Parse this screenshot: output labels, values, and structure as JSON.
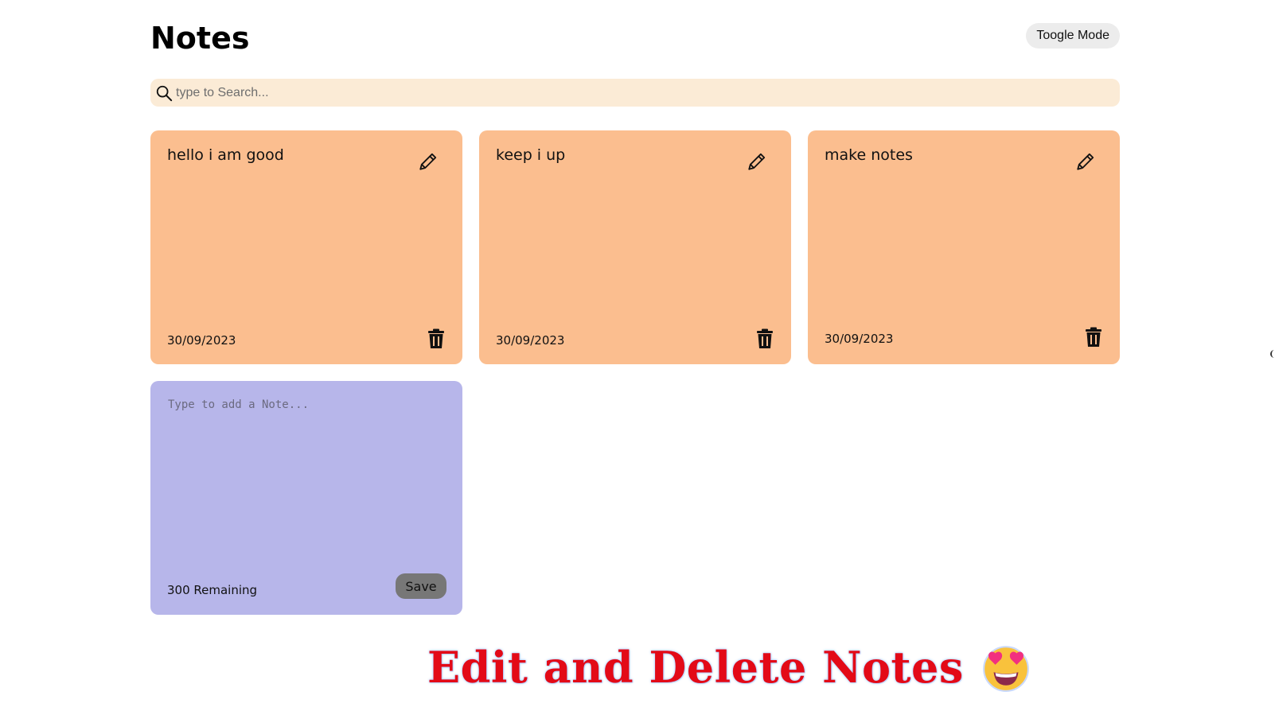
{
  "header": {
    "title": "Notes",
    "toggle_label": "Toogle Mode"
  },
  "search": {
    "placeholder": "type to Search...",
    "icon": "search-icon"
  },
  "notes": [
    {
      "text": "hello i am good",
      "date": "30/09/2023"
    },
    {
      "text": "keep i up",
      "date": "30/09/2023"
    },
    {
      "text": "make notes",
      "date": "30/09/2023"
    }
  ],
  "new_note": {
    "placeholder": "Type to add a Note...",
    "remaining": "300 Remaining",
    "save_label": "Save"
  },
  "caption": {
    "text": "Edit and Delete Notes",
    "emoji_icon": "star-struck-heart-eyes-emoji-icon"
  },
  "colors": {
    "note_bg": "#fbbe8f",
    "new_note_bg": "#b7b6ea",
    "search_bg": "#fbebd6",
    "toggle_bg": "#ececec",
    "save_bg": "#777777",
    "caption_color": "#e30a17"
  }
}
